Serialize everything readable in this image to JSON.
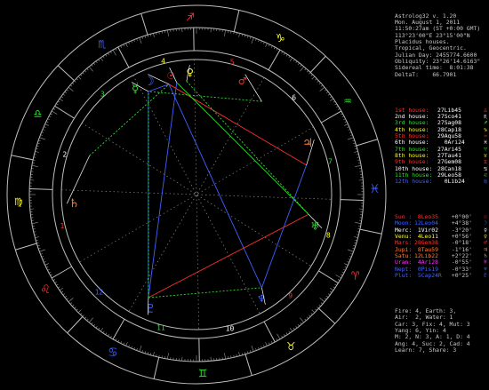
{
  "header": [
    "Astrolog32 v. 1.20",
    "Mon. August 1, 2011",
    "11:50:27am (ST +0:00 GMT)",
    "113°23'00\"E 23°15'00\"N",
    "Placidus houses.",
    "Tropical, Geocentric.",
    "Julian Day: 2455774.6600",
    "Obliquity: 23°26'14.6163\"",
    "Sidereal time:  8:01:38",
    "DeltaT:    66.7901"
  ],
  "houses": [
    {
      "label": "1st house:",
      "pos": "27Lib45",
      "color": "#ff3030",
      "glyph": "♎"
    },
    {
      "label": "2nd house:",
      "pos": "27Sco41",
      "color": "#ffffff",
      "glyph": "♏"
    },
    {
      "label": "3rd house:",
      "pos": "27Sag08",
      "color": "#30e030",
      "glyph": "♐"
    },
    {
      "label": "4th house:",
      "pos": "28Cap18",
      "color": "#ffff30",
      "glyph": "♑"
    },
    {
      "label": "5th house:",
      "pos": "29Aqu58",
      "color": "#ff3030",
      "glyph": "♒"
    },
    {
      "label": "6th house:",
      "pos": "  0Ari24",
      "color": "#ffffff",
      "glyph": "♓"
    },
    {
      "label": "7th house:",
      "pos": "27Ari45",
      "color": "#30e030",
      "glyph": "♈"
    },
    {
      "label": "8th house:",
      "pos": "27Tau41",
      "color": "#ffff30",
      "glyph": "♉"
    },
    {
      "label": "9th house:",
      "pos": "27Gem08",
      "color": "#ff3030",
      "glyph": "♊"
    },
    {
      "label": "10th house:",
      "pos": "28Can18",
      "color": "#ffffff",
      "glyph": "♋"
    },
    {
      "label": "11th house:",
      "pos": "29Leo58",
      "color": "#30e030",
      "glyph": "♌"
    },
    {
      "label": "12th house:",
      "pos": "  0Lib24",
      "color": "#4060ff",
      "glyph": "♍"
    }
  ],
  "planets": [
    {
      "name": "Sun :",
      "pos": " 8Leo35",
      "aspect": " +0°00'",
      "color": "#ff3030",
      "glyph": "☉"
    },
    {
      "name": "Moon:",
      "pos": "12Leo04",
      "aspect": " +4°38'",
      "color": "#4060ff",
      "glyph": "☽"
    },
    {
      "name": "Merc:",
      "pos": " 1Vir02",
      "aspect": " -3°20'",
      "color": "#ffffff",
      "glyph": "☿"
    },
    {
      "name": "Venu:",
      "pos": " 4Leo11",
      "aspect": " +0°56'",
      "color": "#ffff30",
      "glyph": "♀"
    },
    {
      "name": "Mars:",
      "pos": "28Gem38",
      "aspect": " -0°18'",
      "color": "#ff3030",
      "glyph": "♂"
    },
    {
      "name": "Jupi:",
      "pos": " 8Tau59",
      "aspect": " -1°16'",
      "color": "#ff8030",
      "glyph": "♃"
    },
    {
      "name": "Satu:",
      "pos": "12Lib22",
      "aspect": " +2°22'",
      "color": "#ff8030",
      "glyph": "♄"
    },
    {
      "name": "Uran:",
      "pos": " 4Ari28",
      "aspect": " -0°55'",
      "color": "#ff30ff",
      "glyph": "♅"
    },
    {
      "name": "Nept:",
      "pos": " 0Pis19",
      "aspect": " -0°33'",
      "color": "#4060ff",
      "glyph": "♆"
    },
    {
      "name": "Plut:",
      "pos": " 5Cap24R",
      "aspect": " +0°25'",
      "color": "#4060ff",
      "glyph": "♇"
    }
  ],
  "elements": [
    "Fire: 4, Earth: 3,",
    "Air:  2, Water: 1",
    "Car: 3, Fix: 4, Mut: 3",
    "Yang: 6, Yin: 4",
    "M: 2, N: 3, A: 1, D: 4",
    "Ang: 4, Suc: 2, Cad: 4",
    "Learn: 7, Share: 3"
  ],
  "house_numbers": [
    "1",
    "2",
    "3",
    "4",
    "5",
    "6",
    "7",
    "8",
    "9",
    "10",
    "11",
    "12"
  ],
  "sign_glyphs": [
    "♈",
    "♉",
    "♊",
    "♋",
    "♌",
    "♍",
    "♎",
    "♏",
    "♐",
    "♑",
    "♒",
    "♓"
  ],
  "sign_colors": [
    "#ff3030",
    "#ffff30",
    "#30e030",
    "#4060ff",
    "#ff3030",
    "#ffff30",
    "#30e030",
    "#4060ff",
    "#ff3030",
    "#ffff30",
    "#30e030",
    "#4060ff"
  ],
  "wheel_planets": [
    {
      "glyph": "☽",
      "color": "#4060ff"
    },
    {
      "glyph": "☉",
      "color": "#ff3030"
    },
    {
      "glyph": "♀",
      "color": "#ffff30"
    },
    {
      "glyph": "☿",
      "color": "#30e030"
    },
    {
      "glyph": "♂",
      "color": "#ff3030"
    },
    {
      "glyph": "♄",
      "color": "#ff8030"
    },
    {
      "glyph": "♃",
      "color": "#ff8030"
    },
    {
      "glyph": "♅",
      "color": "#30e030"
    },
    {
      "glyph": "♇",
      "color": "#4060ff"
    },
    {
      "glyph": "♆",
      "color": "#4060ff"
    }
  ]
}
